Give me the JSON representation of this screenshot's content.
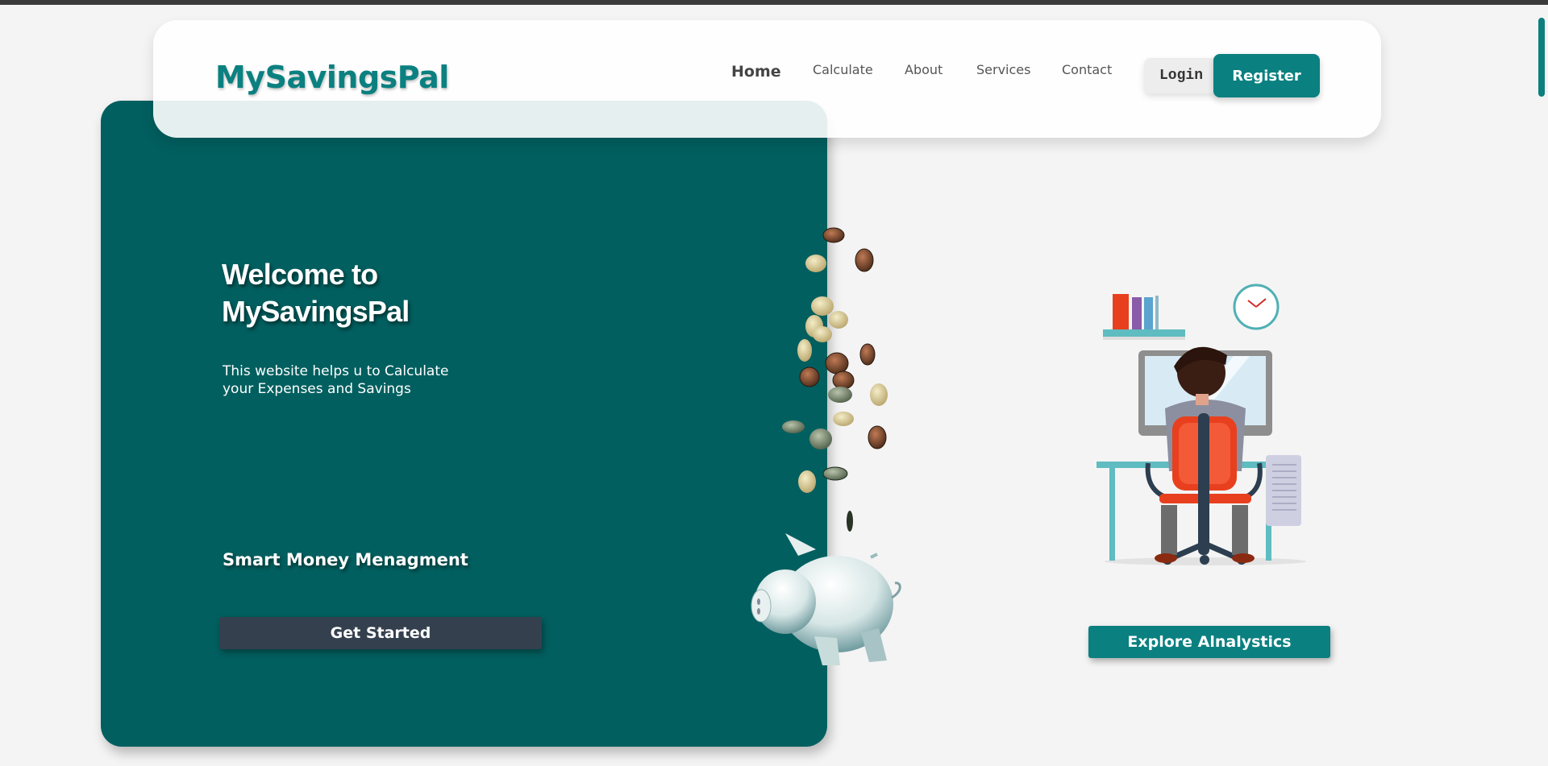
{
  "brand": {
    "name": "MySavingsPal",
    "accent_color": "#0b8080",
    "hero_color": "#025f5f"
  },
  "nav": {
    "links": [
      {
        "label": "Home",
        "active": true
      },
      {
        "label": "Calculate",
        "active": false
      },
      {
        "label": "About",
        "active": false
      },
      {
        "label": "Services",
        "active": false
      },
      {
        "label": "Contact",
        "active": false
      }
    ],
    "login_label": "Login",
    "register_label": "Register"
  },
  "hero": {
    "title": "Welcome to MySavingsPal",
    "description": "This website helps u to Calculate your Expenses and Savings",
    "tagline": "Smart Money Menagment",
    "cta_label": "Get Started",
    "images": [
      "falling-coins-icon",
      "piggy-bank-icon"
    ]
  },
  "side": {
    "illustration": "person-at-desk-illustration",
    "explore_label": "Explore Alnalystics"
  }
}
